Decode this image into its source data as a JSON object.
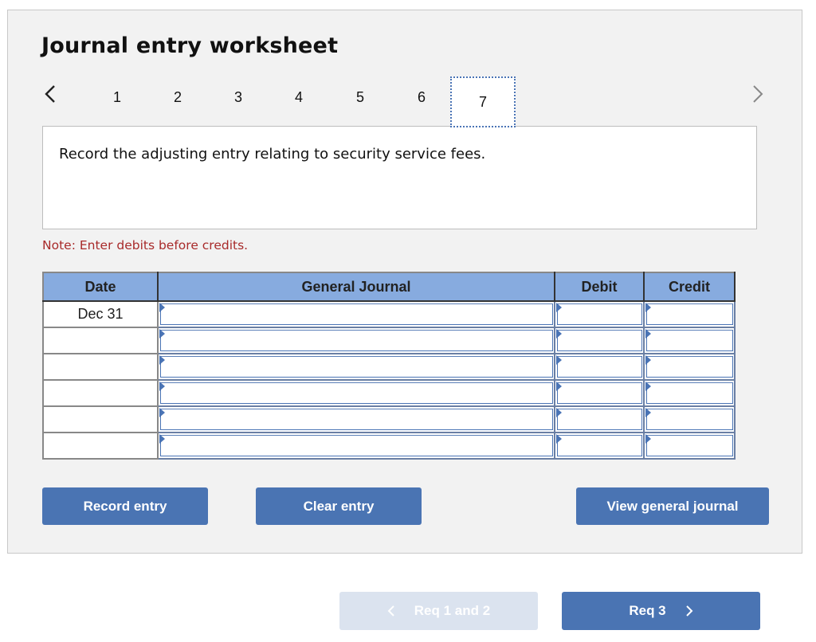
{
  "worksheet": {
    "title": "Journal entry worksheet",
    "nav": {
      "prev_icon": "chevron-left-icon",
      "next_icon": "chevron-right-icon",
      "tabs": [
        "1",
        "2",
        "3",
        "4",
        "5",
        "6",
        "7"
      ],
      "active_tab": "7"
    },
    "question": "Record the adjusting entry relating to security service fees.",
    "note": "Note: Enter debits before credits.",
    "table": {
      "headers": {
        "date": "Date",
        "general_journal": "General Journal",
        "debit": "Debit",
        "credit": "Credit"
      },
      "rows": [
        {
          "date": "Dec 31",
          "account": "",
          "debit": "",
          "credit": ""
        },
        {
          "date": "",
          "account": "",
          "debit": "",
          "credit": ""
        },
        {
          "date": "",
          "account": "",
          "debit": "",
          "credit": ""
        },
        {
          "date": "",
          "account": "",
          "debit": "",
          "credit": ""
        },
        {
          "date": "",
          "account": "",
          "debit": "",
          "credit": ""
        },
        {
          "date": "",
          "account": "",
          "debit": "",
          "credit": ""
        }
      ]
    },
    "buttons": {
      "record": "Record entry",
      "clear": "Clear entry",
      "view": "View general journal"
    }
  },
  "footer": {
    "prev_req": "Req 1 and 2",
    "next_req": "Req 3"
  },
  "colors": {
    "accent": "#4a74b3",
    "header_fill": "#87abdf",
    "note_text": "#a82a2a",
    "disabled_button": "#dbe3ef"
  }
}
